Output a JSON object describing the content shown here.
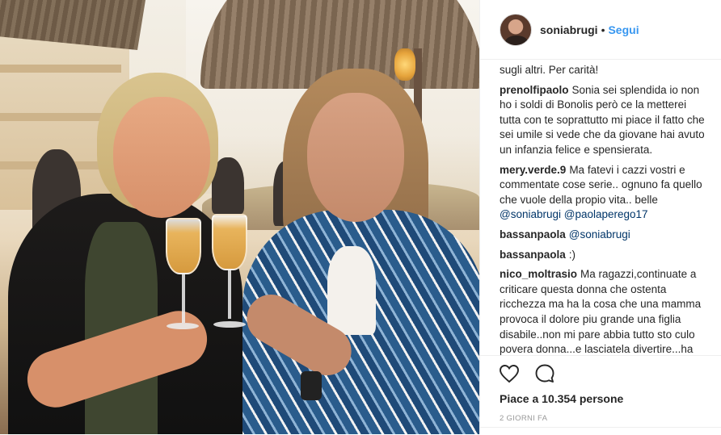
{
  "header": {
    "username": "soniabrugi",
    "separator": "•",
    "follow_label": "Segui"
  },
  "comments": {
    "partial_top": "sugli altri. Per carità!",
    "items": [
      {
        "user": "prenolfipaolo",
        "text": "Sonia sei splendida io non ho i soldi di Bonolis però ce la metterei tutta con te soprattutto mi piace il fatto che sei umile si vede che da giovane hai avuto un infanzia felice e spensierata."
      },
      {
        "user": "mery.verde.9",
        "text": "Ma fatevi i cazzi vostri e commentate cose serie.. ognuno fa quello che vuole della propio vita.. belle",
        "mentions": "@soniabrugi @paolaperego17"
      },
      {
        "user": "bassanpaola",
        "text": "",
        "mentions": "@soniabrugi"
      },
      {
        "user": "bassanpaola",
        "text": ":)"
      },
      {
        "user": "nico_moltrasio",
        "text": "Ma ragazzi,continuate a criticare questa donna che ostenta ricchezza ma ha la cosa che una mamma provoca il dolore piu grande una figlia disabile..non mi pare abbia tutto sto culo povera donna...e lasciatela divertire...ha solo dei beni effimeri"
      }
    ]
  },
  "actions": {
    "like_icon": "heart-icon",
    "comment_icon": "comment-bubble-icon",
    "likes_text": "Piace a 10.354 persone",
    "time_text": "2 GIORNI FA"
  },
  "colors": {
    "accent": "#3897f0",
    "mention": "#003569",
    "muted": "#999999",
    "text": "#262626",
    "border": "#efefef"
  }
}
